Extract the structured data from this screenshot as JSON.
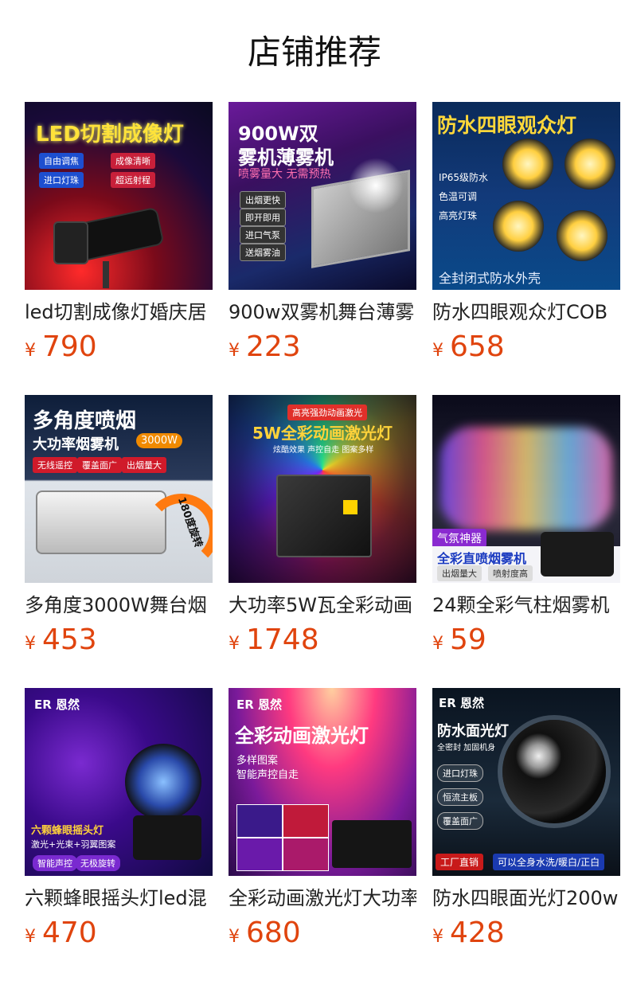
{
  "page_title": "店铺推荐",
  "products": [
    {
      "name": "led切割成像灯婚庆居",
      "currency": "¥",
      "price": "790",
      "image_text": {
        "headline": "LED切割成像灯",
        "tags": [
          "自由调焦",
          "成像清晰",
          "进口灯珠",
          "超远射程"
        ]
      }
    },
    {
      "name": "900w双雾机舞台薄雾",
      "currency": "¥",
      "price": "223",
      "image_text": {
        "headline1": "900W双",
        "headline2": "雾机薄雾机",
        "sub": "喷雾量大 无需预热",
        "tags": [
          "出烟更快",
          "即开即用",
          "进口气泵",
          "送烟雾油"
        ]
      }
    },
    {
      "name": "防水四眼观众灯COB",
      "currency": "¥",
      "price": "658",
      "image_text": {
        "headline": "防水四眼观众灯",
        "tags": [
          "IP65级防水",
          "色温可调",
          "高亮灯珠"
        ],
        "footer": "全封闭式防水外壳"
      }
    },
    {
      "name": "多角度3000W舞台烟",
      "currency": "¥",
      "price": "453",
      "image_text": {
        "headline": "多角度喷烟",
        "sub": "大功率烟雾机",
        "badge": "3000W",
        "tags": [
          "无线遥控",
          "覆盖面广",
          "出烟量大"
        ],
        "rotate": "180度旋转"
      }
    },
    {
      "name": "大功率5W瓦全彩动画",
      "currency": "¥",
      "price": "1748",
      "image_text": {
        "top": "高亮强劲动画激光",
        "headline": "5W全彩动画激光灯",
        "sub": "炫酷效果  声控自走  图案多样"
      }
    },
    {
      "name": "24颗全彩气柱烟雾机",
      "currency": "¥",
      "price": "59",
      "image_text": {
        "tag": "气氛神器",
        "headline": "全彩直喷烟雾机",
        "chips": [
          "出烟量大",
          "喷射度高"
        ]
      }
    },
    {
      "name": "六颗蜂眼摇头灯led混",
      "currency": "¥",
      "price": "470",
      "image_text": {
        "brand": "恩然",
        "headline": "六颗蜂眼摇头灯",
        "sub": "激光+光束+羽翼图案",
        "chips": [
          "智能声控",
          "无极旋转"
        ]
      }
    },
    {
      "name": "全彩动画激光灯大功率",
      "currency": "¥",
      "price": "680",
      "image_text": {
        "brand": "恩然",
        "headline": "全彩动画激光灯",
        "sub1": "多样图案",
        "sub2": "智能声控自走"
      }
    },
    {
      "name": "防水四眼面光灯200w",
      "currency": "¥",
      "price": "428",
      "image_text": {
        "brand": "恩然",
        "headline": "防水面光灯",
        "sub": "全密封 加固机身",
        "tags": [
          "进口灯珠",
          "恒流主板",
          "覆盖面广"
        ],
        "footer_left": "工厂直销",
        "footer_right": "可以全身水洗/暖白/正白"
      }
    }
  ]
}
